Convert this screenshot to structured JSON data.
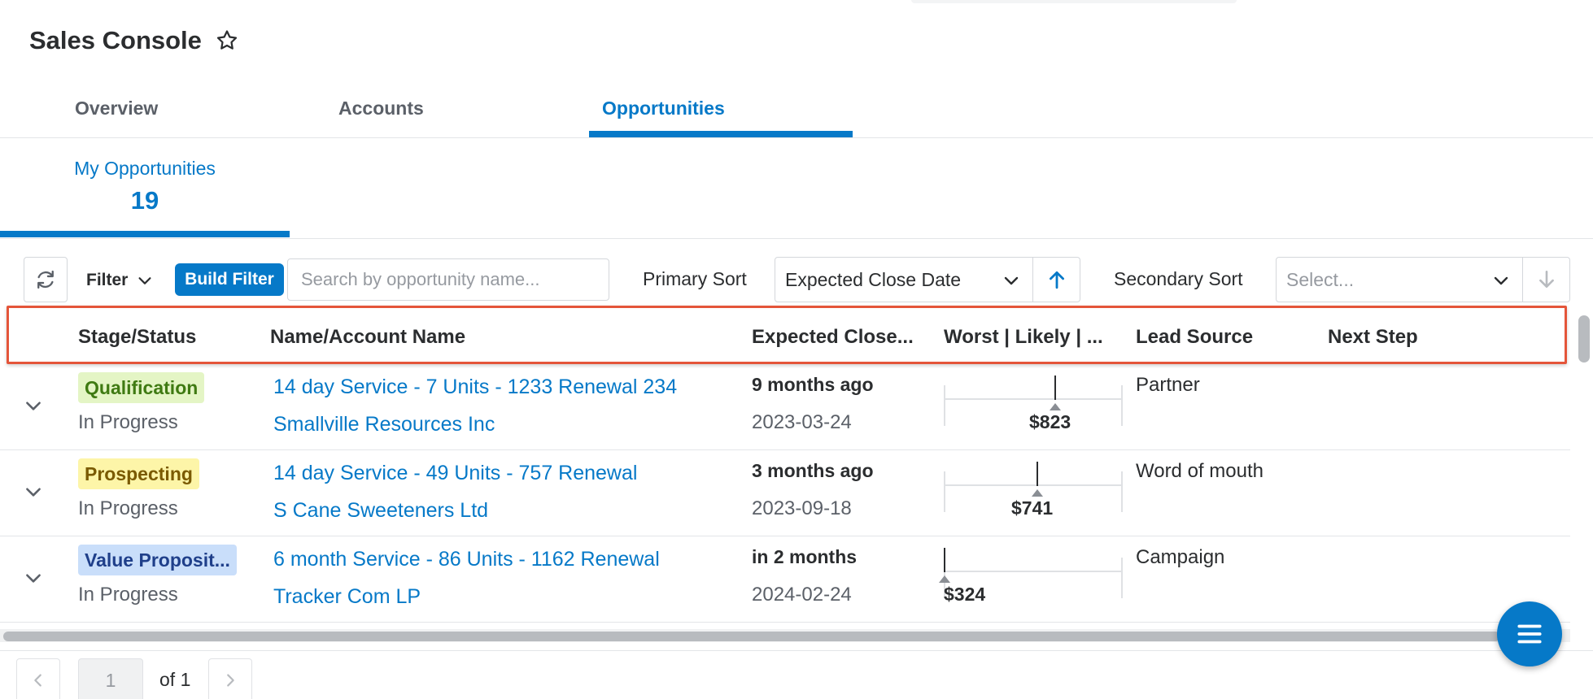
{
  "header": {
    "title": "Sales Console"
  },
  "main_tabs": [
    {
      "label": "Overview"
    },
    {
      "label": "Accounts"
    },
    {
      "label": "Opportunities"
    }
  ],
  "sub_tab": {
    "label": "My Opportunities",
    "count": "19"
  },
  "toolbar": {
    "filter_label": "Filter",
    "build_filter_label": "Build Filter",
    "search_placeholder": "Search by opportunity name...",
    "primary_sort_label": "Primary Sort",
    "primary_sort_value": "Expected Close Date",
    "secondary_sort_label": "Secondary Sort",
    "secondary_sort_placeholder": "Select..."
  },
  "table": {
    "columns": [
      "Stage/Status",
      "Name/Account Name",
      "Expected Close...",
      "Worst | Likely | ...",
      "Lead Source",
      "Next Step"
    ],
    "rows": [
      {
        "stage": "Qualification",
        "status": "In Progress",
        "name": "14 day Service - 7 Units - 1233 Renewal 234",
        "account": "Smallville Resources Inc",
        "close_relative": "9 months ago",
        "close_date": "2023-03-24",
        "likely_value": "$823",
        "likely_position": 0.62,
        "lead_source": "Partner",
        "next_step": ""
      },
      {
        "stage": "Prospecting",
        "status": "In Progress",
        "name": "14 day Service - 49 Units - 757 Renewal",
        "account": "S Cane Sweeteners Ltd",
        "close_relative": "3 months ago",
        "close_date": "2023-09-18",
        "likely_value": "$741",
        "likely_position": 0.52,
        "lead_source": "Word of mouth",
        "next_step": ""
      },
      {
        "stage": "Value Proposit...",
        "status": "In Progress",
        "name": "6 month Service - 86 Units - 1162 Renewal",
        "account": "Tracker Com LP",
        "close_relative": "in 2 months",
        "close_date": "2024-02-24",
        "likely_value": "$324",
        "likely_position": 0.0,
        "lead_source": "Campaign",
        "next_step": ""
      }
    ]
  },
  "pagination": {
    "current_page": "1",
    "of_label": "of 1"
  },
  "colors": {
    "accent": "#0679c8",
    "highlight_border": "#e4553a",
    "stage_qualification_bg": "#e4f5c5",
    "stage_qualification_fg": "#3f7a12",
    "stage_prospecting_bg": "#fdf5a8",
    "stage_prospecting_fg": "#7a5a00",
    "stage_value_bg": "#c9defa",
    "stage_value_fg": "#1f3f8a"
  },
  "icons": {
    "favorite": "star-icon",
    "refresh": "refresh-icon",
    "filter_toggle": "chevron-down-icon",
    "sort_ascending": "arrow-up-icon",
    "sort_descending": "arrow-down-icon",
    "row_expand": "chevron-down-icon",
    "menu": "hamburger-icon",
    "prev_page": "chevron-left-icon",
    "next_page": "chevron-right-icon"
  }
}
